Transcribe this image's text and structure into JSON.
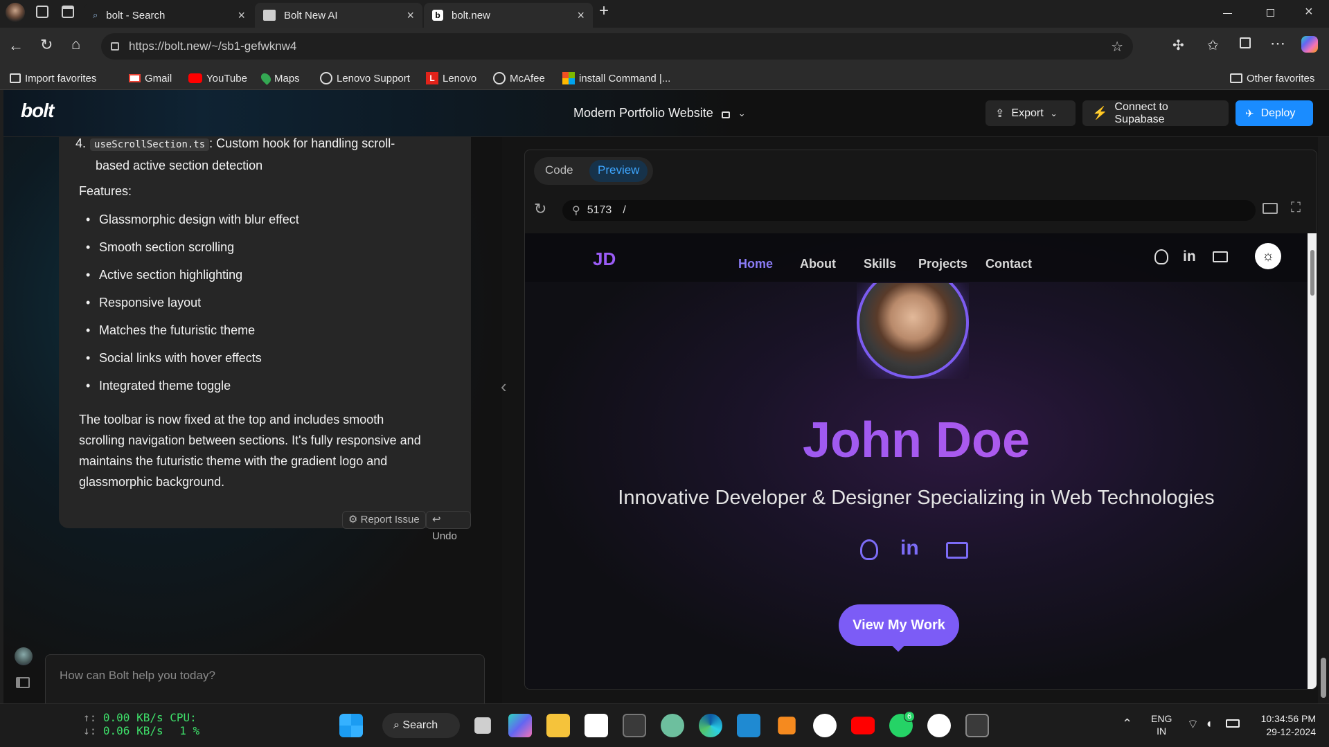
{
  "browser": {
    "tabs": [
      {
        "label": "bolt - Search"
      },
      {
        "label": "Bolt New AI"
      },
      {
        "label": "bolt.new"
      }
    ],
    "url": "https://bolt.new/~/sb1-gefwknw4",
    "bookmarks": [
      "Import favorites",
      "Gmail",
      "YouTube",
      "Maps",
      "Lenovo Support",
      "Lenovo",
      "McAfee",
      "install Command |...",
      "Other favorites"
    ]
  },
  "app": {
    "logo": "bolt",
    "project_title": "Modern Portfolio Website",
    "export_label": "Export",
    "supabase_label": "Connect to Supabase",
    "deploy_label": "Deploy"
  },
  "chat": {
    "item4_num": "4.",
    "item4_code": "useScrollSection.ts",
    "item4_text": ": Custom hook for handling scroll-",
    "item4_text2": "based active section detection",
    "features_heading": "Features:",
    "features": [
      "Glassmorphic design with blur effect",
      "Smooth section scrolling",
      "Active section highlighting",
      "Responsive layout",
      "Matches the futuristic theme",
      "Social links with hover effects",
      "Integrated theme toggle"
    ],
    "summary_lines": [
      "The toolbar is now fixed at the top and includes smooth",
      "scrolling navigation between sections. It's fully responsive and",
      "maintains the futuristic theme with the gradient logo and",
      "glassmorphic background."
    ],
    "report_label": "Report Issue",
    "undo_label": "Undo",
    "prompt_placeholder": "How can Bolt help you today?"
  },
  "preview": {
    "tab_code": "Code",
    "tab_preview": "Preview",
    "port": "5173",
    "path": "/"
  },
  "site": {
    "logo": "JD",
    "nav": [
      "Home",
      "About",
      "Skills",
      "Projects",
      "Contact"
    ],
    "name": "John Doe",
    "tagline": "Innovative Developer & Designer Specializing in Web Technologies",
    "cta": "View My Work"
  },
  "taskbar": {
    "net_up": "0.00 KB/s",
    "net_down": "0.06 KB/s",
    "cpu_label": "CPU:",
    "cpu_value": "1 %",
    "search_label": "Search",
    "lang1": "ENG",
    "lang2": "IN",
    "time": "10:34:56 PM",
    "date": "29-12-2024",
    "badge": "6"
  },
  "colors": {
    "accent": "#1a8cff",
    "purple": "#8b5cf6",
    "magenta": "#c058e8"
  }
}
